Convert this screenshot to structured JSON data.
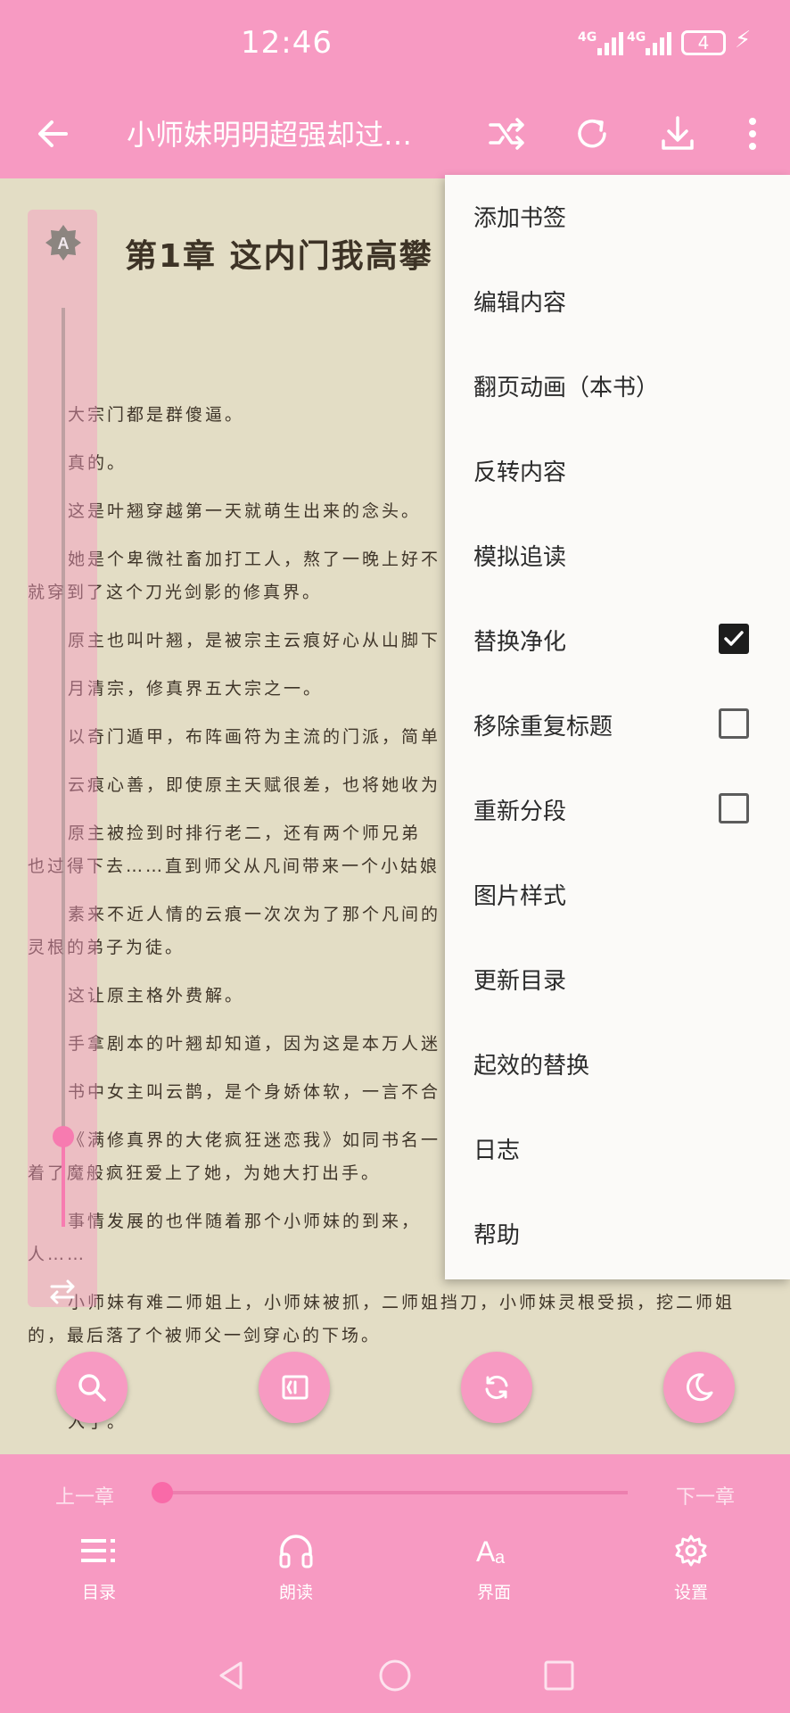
{
  "status_bar": {
    "time": "12:46",
    "signal_1": "4G",
    "signal_2": "4G",
    "battery": "4"
  },
  "toolbar": {
    "title": "小师妹明明超强却过…"
  },
  "content": {
    "chapter_title": "第1章 这内门我高攀",
    "paragraphs": [
      "大宗门都是群傻逼。",
      "真的。",
      "这是叶翘穿越第一天就萌生出来的念头。",
      "她是个卑微社畜加打工人，熬了一晚上好不",
      "就穿到了这个刀光剑影的修真界。",
      "原主也叫叶翘，是被宗主云痕好心从山脚下",
      "月清宗，修真界五大宗之一。",
      "以奇门遁甲，布阵画符为主流的门派，简单",
      "云痕心善，即使原主天赋很差，也将她收为",
      "原主被捡到时排行老二，还有两个师兄弟",
      "也过得下去……直到师父从凡间带来一个小姑娘",
      "素来不近人情的云痕一次次为了那个凡间的",
      "灵根的弟子为徒。",
      "这让原主格外费解。",
      "手拿剧本的叶翘却知道，因为这是本万人迷",
      "书中女主叫云鹊，是个身娇体软，一言不合",
      "《满修真界的大佬疯狂迷恋我》如同书名一",
      "着了魔般疯狂爱上了她，为她大打出手。",
      "事情发展的也伴随着那个小师妹的到来，",
      "人……",
      "小师妹有难二师姐上，小师妹被抓，二师姐挡刀，小师妹灵根受损，挖二师姐",
      "的，最后落了个被师父一剑穿心的下场。",
      "入了。"
    ]
  },
  "brightness": {
    "auto_label": "A"
  },
  "menu": {
    "items": [
      {
        "label": "添加书签"
      },
      {
        "label": "编辑内容"
      },
      {
        "label": "翻页动画（本书）"
      },
      {
        "label": "反转内容"
      },
      {
        "label": "模拟追读"
      },
      {
        "label": "替换净化",
        "checked": true
      },
      {
        "label": "移除重复标题",
        "checked": false
      },
      {
        "label": "重新分段",
        "checked": false
      },
      {
        "label": "图片样式"
      },
      {
        "label": "更新目录"
      },
      {
        "label": "起效的替换"
      },
      {
        "label": "日志"
      },
      {
        "label": "帮助"
      }
    ]
  },
  "bottom": {
    "prev_chapter": "上一章",
    "next_chapter": "下一章",
    "chapter_progress": 0,
    "nav": [
      {
        "label": "目录",
        "icon": "toc-icon"
      },
      {
        "label": "朗读",
        "icon": "headphones-icon"
      },
      {
        "label": "界面",
        "icon": "font-icon"
      },
      {
        "label": "设置",
        "icon": "gear-icon"
      }
    ]
  },
  "colors": {
    "accent": "#f79ac2",
    "page_bg": "#e3ddc5",
    "menu_bg": "#fbfaf8"
  }
}
